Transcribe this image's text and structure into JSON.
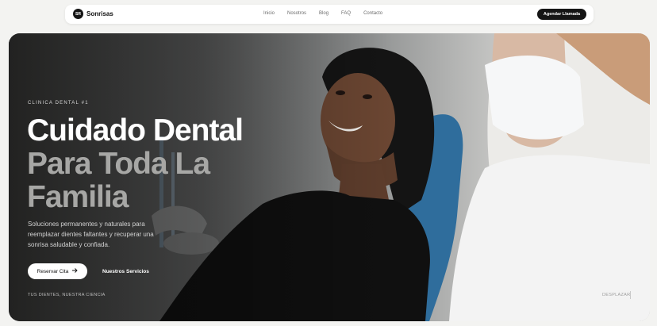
{
  "nav": {
    "brand_initials": "SR",
    "brand_name": "Sonrisas",
    "links": [
      "Inicio",
      "Nosotros",
      "Blog",
      "FAQ",
      "Contacto"
    ],
    "cta_label": "Agendar Llamada"
  },
  "hero": {
    "eyebrow": "CLINICA DENTAL #1",
    "headline_line1": "Cuidado Dental",
    "headline_line2": "Para Toda La",
    "headline_line3": "Familia",
    "subtext": "Soluciones permanentes y naturales para reemplazar dientes faltantes y recuperar una sonrisa saludable y confiada.",
    "primary_button": "Reservar Cita",
    "secondary_button": "Nuestros Servicios",
    "footer_left": "TUS DIENTES, NUESTRA CIENCIA",
    "footer_right": "DESPLAZAR"
  },
  "icons": {
    "primary_button_icon": "arrow-right-icon"
  },
  "colors": {
    "brand_dark": "#151515",
    "headline_white": "#ffffff",
    "headline_gray": "#a7a7a5",
    "page_bg": "#f3f3f1"
  }
}
